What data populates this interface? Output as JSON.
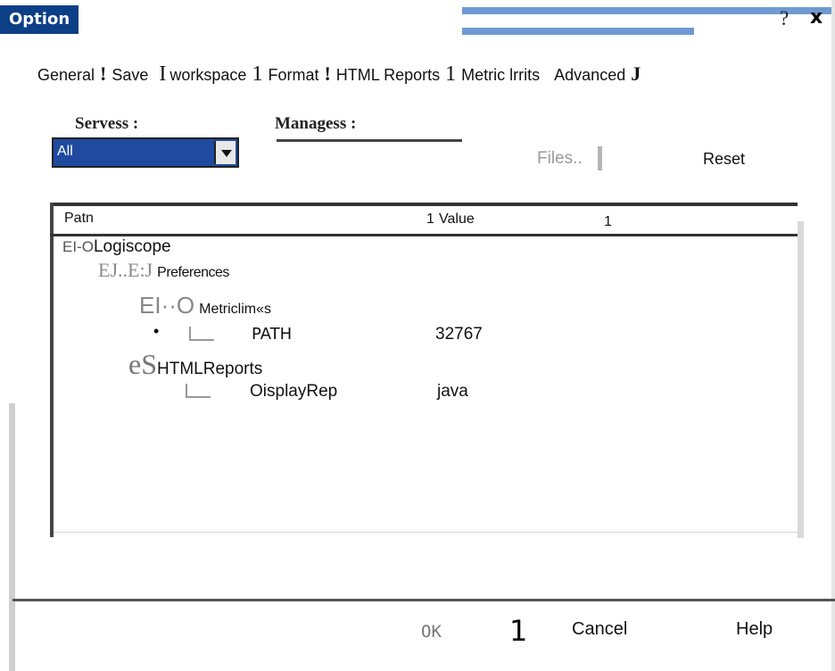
{
  "window": {
    "title": "Option",
    "help_glyph": "?",
    "close_glyph": "x"
  },
  "tabs": [
    {
      "label": "General"
    },
    {
      "sep": "!"
    },
    {
      "label": "Save"
    },
    {
      "sep": "I"
    },
    {
      "label": "workspace"
    },
    {
      "sep": "1"
    },
    {
      "label": "Format"
    },
    {
      "sep": "!"
    },
    {
      "label": "HTML Reports"
    },
    {
      "sep": "1"
    },
    {
      "label": "Metric lrrits"
    },
    {
      "label": "Advanced"
    },
    {
      "sep": "J"
    }
  ],
  "filters": {
    "servers_label": "Servess :",
    "servers_value": "All",
    "managers_label": "Managess :"
  },
  "buttons": {
    "files": "Files..",
    "reset": "Reset",
    "ok": "OK",
    "separator": "1",
    "cancel": "Cancel",
    "help": "Help"
  },
  "grid": {
    "headers": {
      "path": "Patn",
      "sep1": "1",
      "value": "Value",
      "sep2": "1"
    },
    "rows": [
      {
        "glyph": "EI-O",
        "label": "Logiscope",
        "value": ""
      },
      {
        "glyph": "EJ..E:J",
        "label": "Preferences",
        "value": ""
      },
      {
        "glyph": "EI··O",
        "label": "Metriclim«s",
        "value": ""
      },
      {
        "glyph": "•",
        "label": "PATH",
        "value": "32767"
      },
      {
        "glyph": "eS",
        "label": "HTMLReports",
        "value": ""
      },
      {
        "glyph": "",
        "label": "OisplayRep",
        "value": "java"
      }
    ]
  }
}
